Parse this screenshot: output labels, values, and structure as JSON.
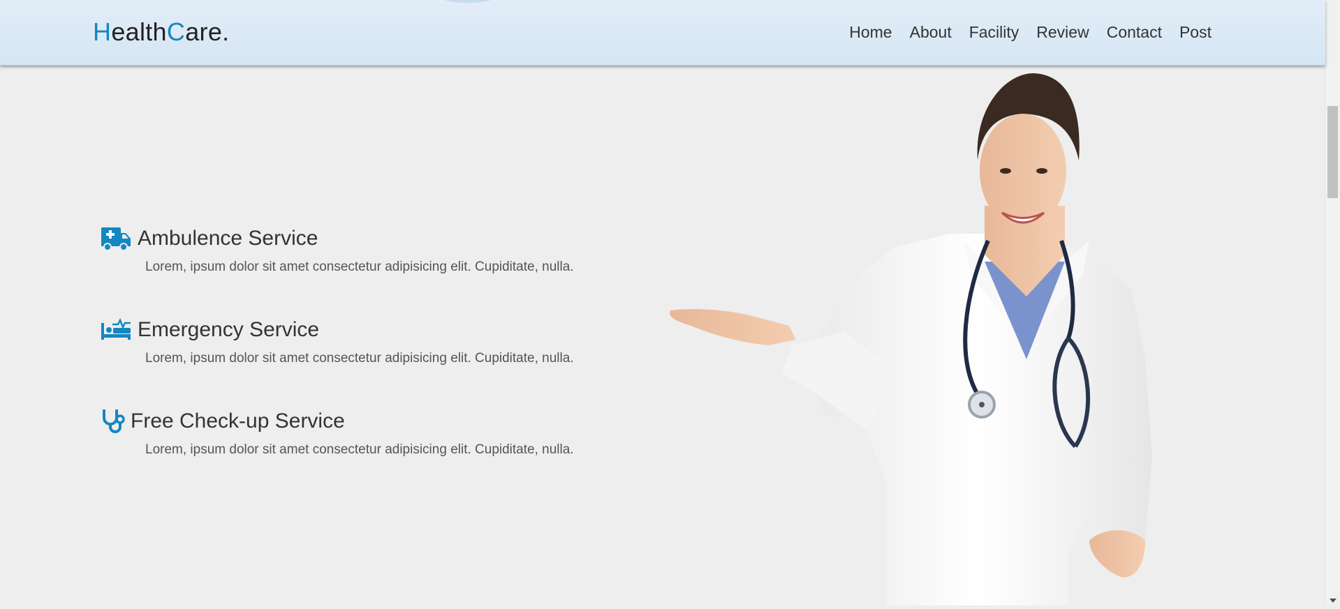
{
  "header": {
    "logo": {
      "first_letter": "H",
      "part1": "ealth",
      "second_letter": "C",
      "part2": "are."
    },
    "nav": [
      "Home",
      "About",
      "Facility",
      "Review",
      "Contact",
      "Post"
    ]
  },
  "services": [
    {
      "icon": "ambulance-icon",
      "title": "Ambulence Service",
      "text": "Lorem, ipsum dolor sit amet consectetur adipisicing elit. Cupiditate, nulla."
    },
    {
      "icon": "procedures-icon",
      "title": "Emergency Service",
      "text": "Lorem, ipsum dolor sit amet consectetur adipisicing elit. Cupiditate, nulla."
    },
    {
      "icon": "stethoscope-icon",
      "title": "Free Check-up Service",
      "text": "Lorem, ipsum dolor sit amet consectetur adipisicing elit. Cupiditate, nulla."
    }
  ],
  "colors": {
    "accent": "#1487c1",
    "background": "#eeeeee",
    "header": "#dbe9f6",
    "text": "#333333"
  },
  "image": {
    "subject": "doctor in white coat with stethoscope presenting with open hand"
  }
}
